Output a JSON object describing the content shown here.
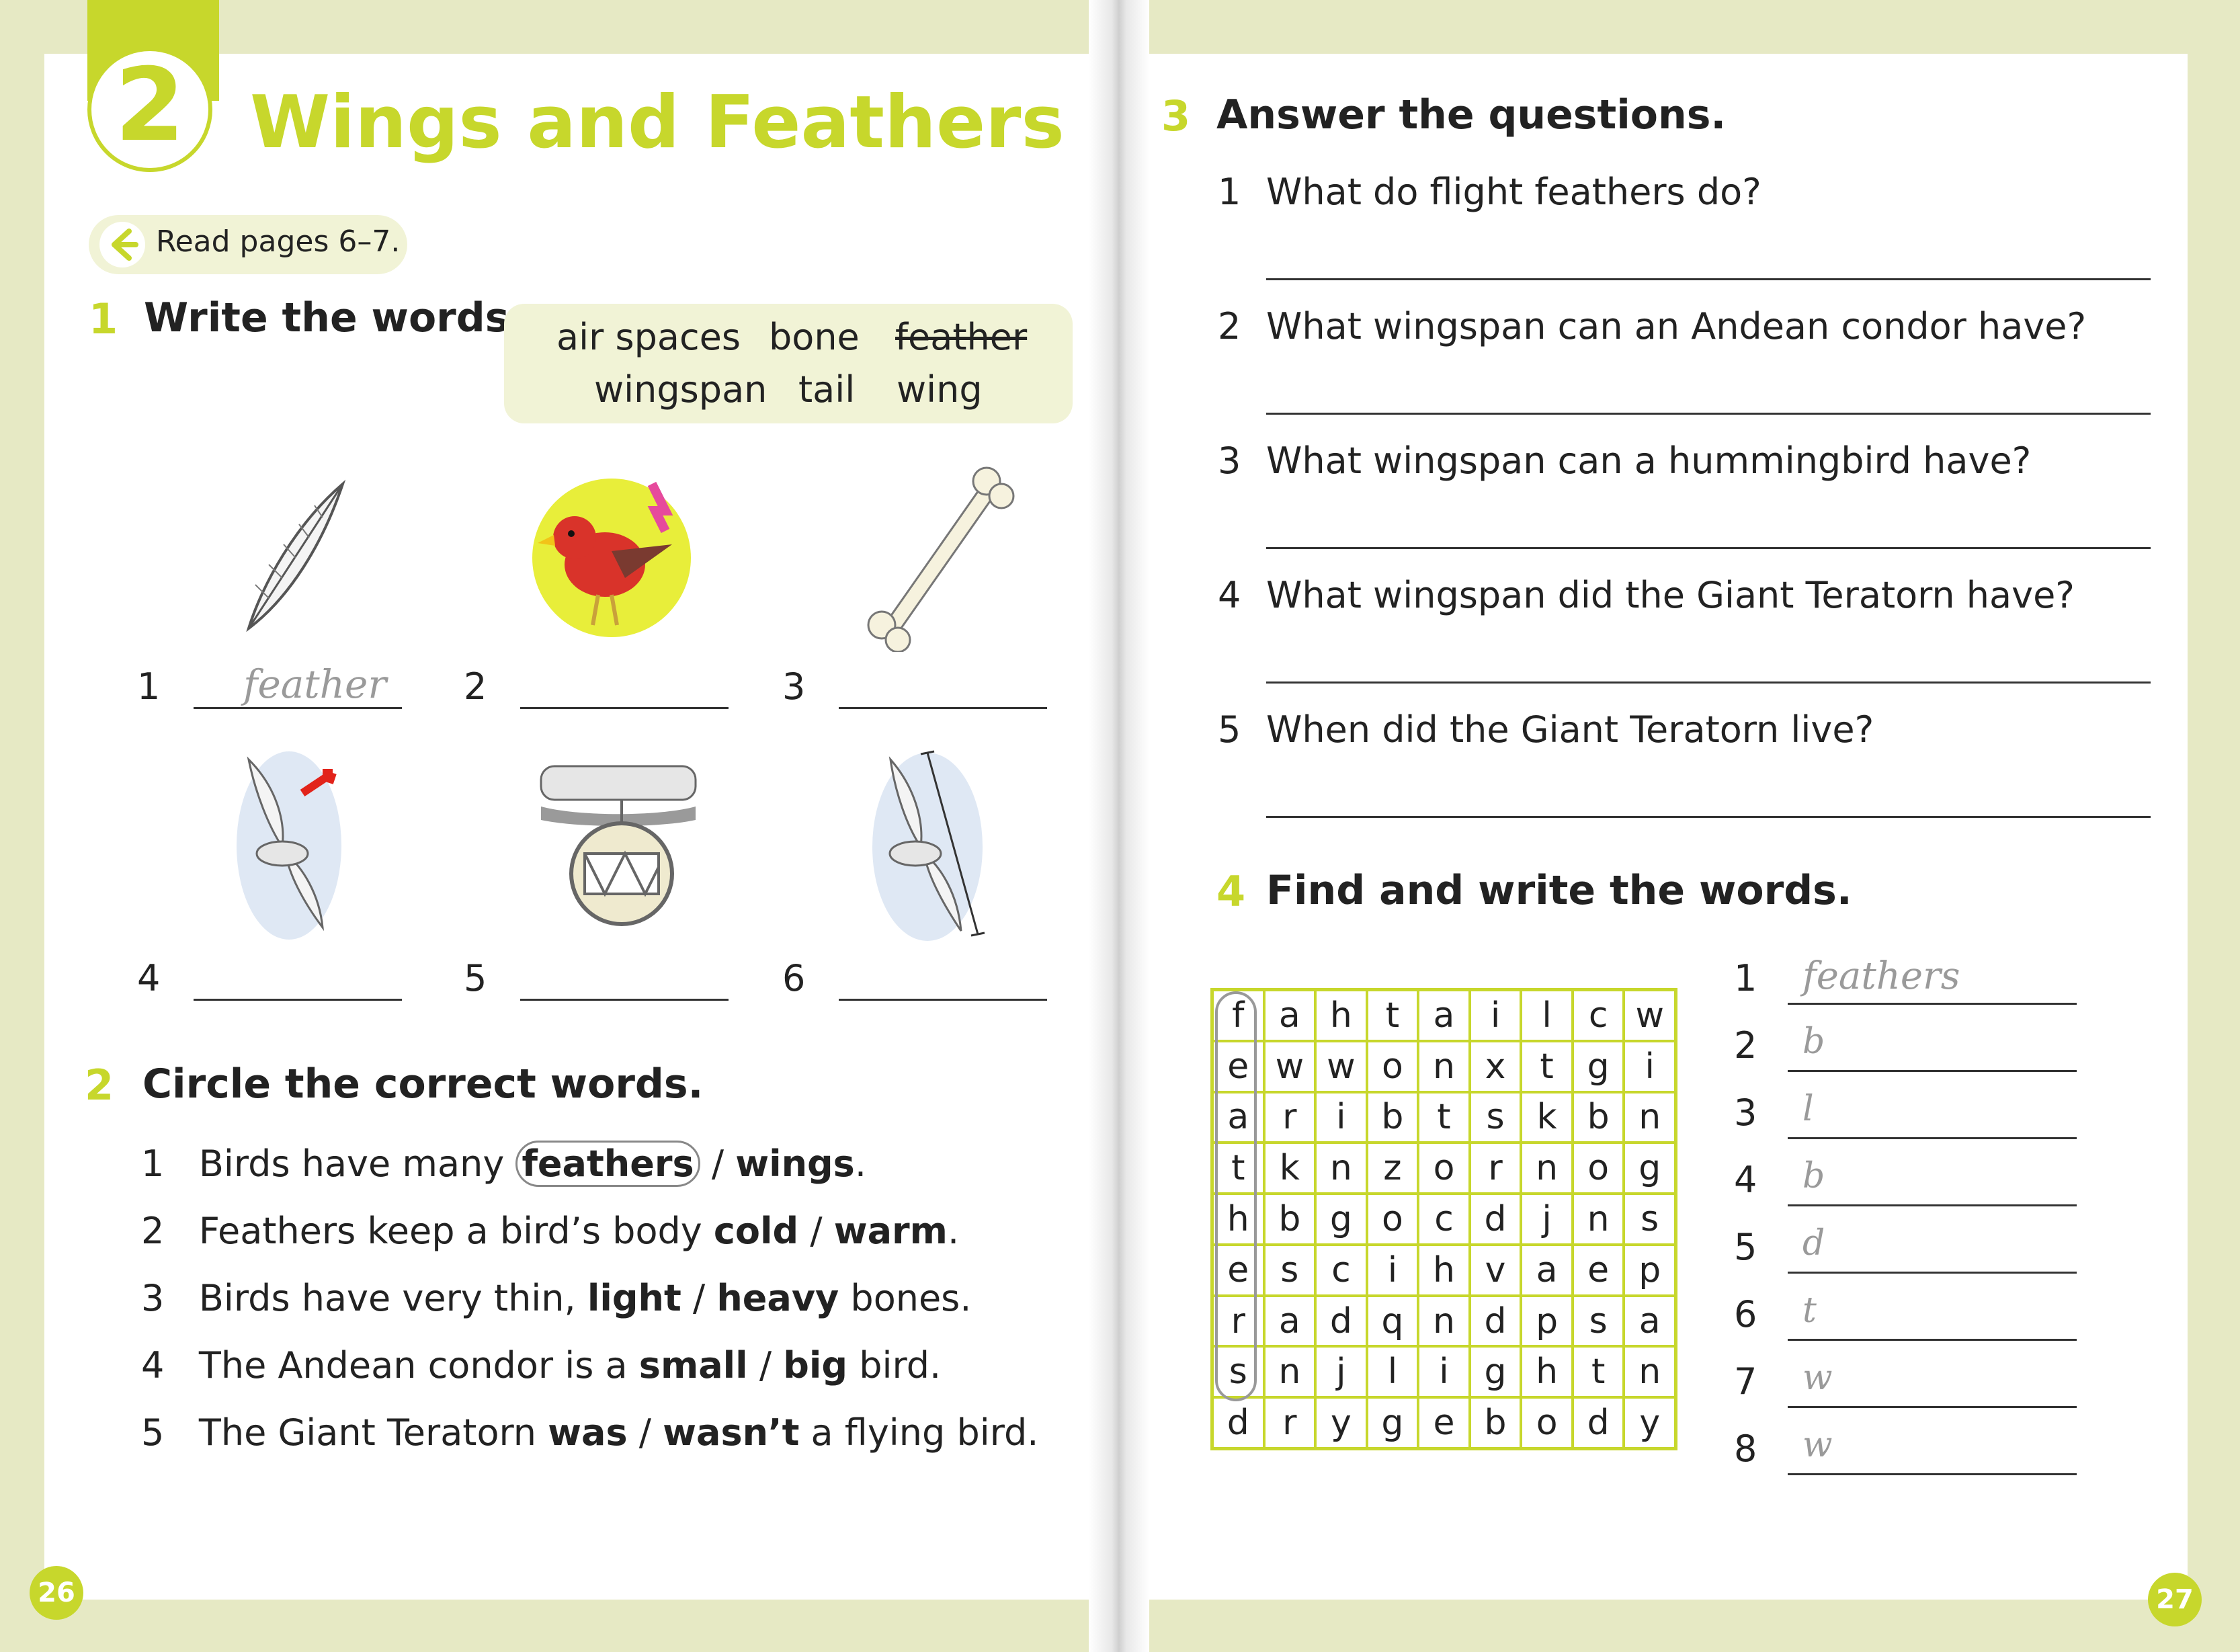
{
  "left": {
    "unit_number": "2",
    "title": "Wings and Feathers",
    "read_note": "Read pages 6–7.",
    "ex1": {
      "num": "1",
      "title": "Write the words.",
      "word_bank": [
        "air spaces",
        "bone",
        "feather",
        "wingspan",
        "tail",
        "wing"
      ],
      "items": [
        {
          "num": "1",
          "answer": "feather",
          "image": "feather-icon"
        },
        {
          "num": "2",
          "answer": "",
          "image": "bird-icon"
        },
        {
          "num": "3",
          "answer": "",
          "image": "bone-icon"
        },
        {
          "num": "4",
          "answer": "",
          "image": "bird-wing-icon"
        },
        {
          "num": "5",
          "answer": "",
          "image": "bone-air-spaces-icon"
        },
        {
          "num": "6",
          "answer": "",
          "image": "bird-wingspan-icon"
        }
      ]
    },
    "ex2": {
      "num": "2",
      "title": "Circle the correct words.",
      "sentences": [
        {
          "num": "1",
          "pre": "Birds have many ",
          "opt1": "feathers",
          "sep": " / ",
          "opt2": "wings",
          "post": "."
        },
        {
          "num": "2",
          "pre": "Feathers keep a bird’s body ",
          "opt1": "cold",
          "sep": " / ",
          "opt2": "warm",
          "post": "."
        },
        {
          "num": "3",
          "pre": "Birds have very thin, ",
          "opt1": "light",
          "sep": " / ",
          "opt2": "heavy",
          "post": " bones."
        },
        {
          "num": "4",
          "pre": "The Andean condor is a ",
          "opt1": "small",
          "sep": " / ",
          "opt2": "big",
          "post": " bird."
        },
        {
          "num": "5",
          "pre": "The Giant Teratorn ",
          "opt1": "was",
          "sep": " / ",
          "opt2": "wasn’t",
          "post": " a flying bird."
        }
      ]
    },
    "page_number": "26"
  },
  "right": {
    "ex3": {
      "num": "3",
      "title": "Answer the questions.",
      "questions": [
        {
          "num": "1",
          "text": "What do flight feathers do?"
        },
        {
          "num": "2",
          "text": "What wingspan can an Andean condor have?"
        },
        {
          "num": "3",
          "text": "What wingspan can a hummingbird have?"
        },
        {
          "num": "4",
          "text": "What wingspan did the Giant Teratorn have?"
        },
        {
          "num": "5",
          "text": "When did the Giant Teratorn live?"
        }
      ]
    },
    "ex4": {
      "num": "4",
      "title": "Find and write the words.",
      "grid": [
        [
          "f",
          "a",
          "h",
          "t",
          "a",
          "i",
          "l",
          "c",
          "w"
        ],
        [
          "e",
          "w",
          "w",
          "o",
          "n",
          "x",
          "t",
          "g",
          "i"
        ],
        [
          "a",
          "r",
          "i",
          "b",
          "t",
          "s",
          "k",
          "b",
          "n"
        ],
        [
          "t",
          "k",
          "n",
          "z",
          "o",
          "r",
          "n",
          "o",
          "g"
        ],
        [
          "h",
          "b",
          "g",
          "o",
          "c",
          "d",
          "j",
          "n",
          "s"
        ],
        [
          "e",
          "s",
          "c",
          "i",
          "h",
          "v",
          "a",
          "e",
          "p"
        ],
        [
          "r",
          "a",
          "d",
          "q",
          "n",
          "d",
          "p",
          "s",
          "a"
        ],
        [
          "s",
          "n",
          "j",
          "l",
          "i",
          "g",
          "h",
          "t",
          "n"
        ],
        [
          "d",
          "r",
          "y",
          "g",
          "e",
          "b",
          "o",
          "d",
          "y"
        ]
      ],
      "answers": [
        {
          "num": "1",
          "text": "feathers"
        },
        {
          "num": "2",
          "text": "b"
        },
        {
          "num": "3",
          "text": "l"
        },
        {
          "num": "4",
          "text": "b"
        },
        {
          "num": "5",
          "text": "d"
        },
        {
          "num": "6",
          "text": "t"
        },
        {
          "num": "7",
          "text": "w"
        },
        {
          "num": "8",
          "text": "w"
        }
      ]
    },
    "page_number": "27"
  }
}
